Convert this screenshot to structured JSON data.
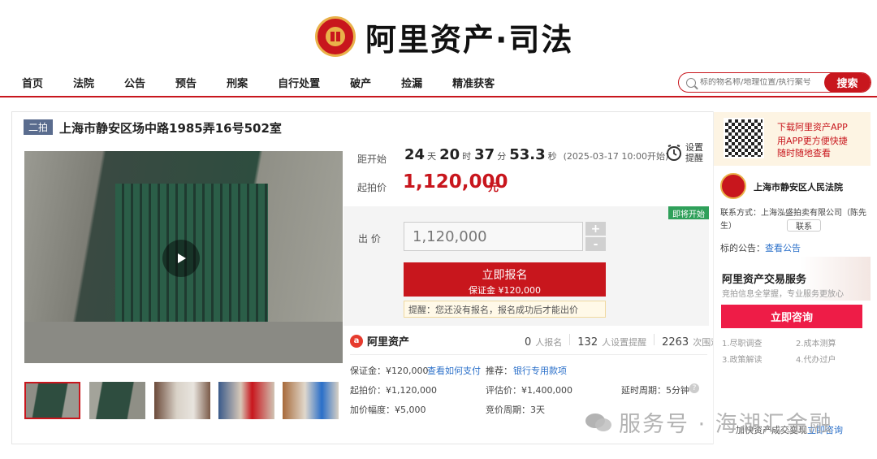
{
  "brand": {
    "name": "阿里资产·司法"
  },
  "nav": {
    "items": [
      "首页",
      "法院",
      "公告",
      "预告",
      "刑案",
      "自行处置",
      "破产",
      "捡漏",
      "精准获客"
    ]
  },
  "search": {
    "placeholder": "标的物名称/地理位置/执行案号",
    "button": "搜索"
  },
  "item": {
    "round_badge": "二拍",
    "title": "上海市静安区场中路1985弄16号502室",
    "countdown": {
      "label": "距开始",
      "days": "24",
      "days_u": "天",
      "hours": "20",
      "hours_u": "时",
      "minutes": "37",
      "minutes_u": "分",
      "seconds": "53.3",
      "seconds_u": "秒",
      "start": "(2025-03-17 10:00开始)"
    },
    "remind": {
      "line1": "设置",
      "line2": "提醒"
    },
    "start_price": {
      "label": "起拍价",
      "value": "1,120,000",
      "unit": "元"
    },
    "status_tag": "即将开始",
    "bid": {
      "label": "出 价",
      "value": "1,120,000",
      "plus": "+",
      "minus": "-"
    },
    "apply": {
      "title": "立即报名",
      "deposit": "保证金 ¥120,000"
    },
    "tip": "提醒：您还没有报名，报名成功后才能出价"
  },
  "stats": {
    "brand": "阿里资产",
    "signups": "0",
    "signups_u": "人报名",
    "reminders": "132",
    "reminders_u": "人设置提醒",
    "views": "2263",
    "views_u": "次围观"
  },
  "details": {
    "deposit": "保证金：¥120,000",
    "how_pay": "查看如何支付",
    "recommend": "推荐：",
    "bank_loan": "银行专用款项",
    "start_price": "起拍价：¥1,120,000",
    "eval_price": "评估价：¥1,400,000",
    "delay": "延时周期：5分钟",
    "increment": "加价幅度：¥5,000",
    "period": "竞价周期：3天"
  },
  "sidebar": {
    "app_title": "下载阿里资产APP",
    "app_desc1": "用APP更方便快捷",
    "app_desc2": "随时随地查看",
    "court": "上海市静安区人民法院",
    "contact": "联系方式：上海泓盛拍卖有限公司（陈先生）",
    "contact_btn": "联系",
    "notice_label": "标的公告：",
    "notice_link": "查看公告",
    "service_title": "阿里资产交易服务",
    "service_desc": "竞拍信息全掌握，专业服务更放心",
    "consult": "立即咨询",
    "services": [
      "1.尽职调查",
      "2.成本测算",
      "3.政策解读",
      "4.代办过户"
    ],
    "footer_text": "加快资产成交变现",
    "footer_link": "立即咨询"
  },
  "watermark": "服务号 · 海湖汇金融",
  "colors": {
    "accent": "#c8161d",
    "link": "#2a6fc9",
    "tag_green": "#2fa05a"
  }
}
